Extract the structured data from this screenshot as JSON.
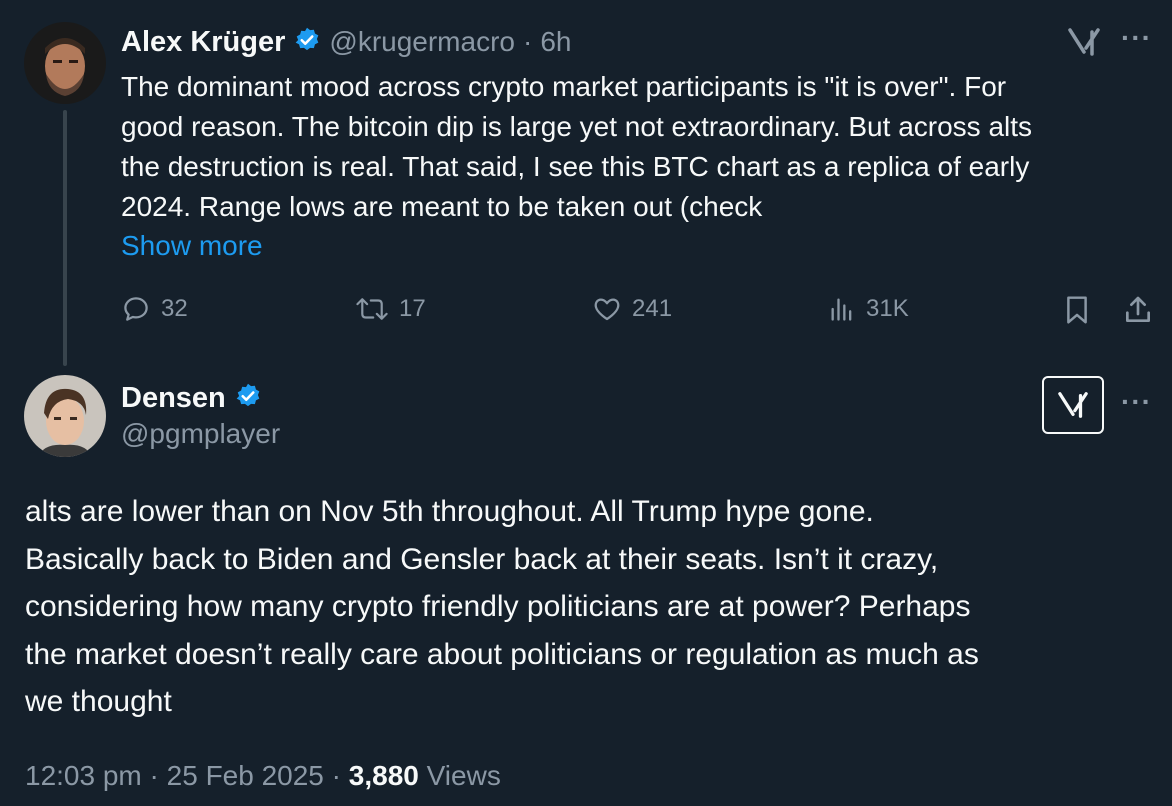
{
  "quoted_tweet": {
    "author_name": "Alex Krüger",
    "handle": "@krugermacro",
    "separator": "·",
    "time_ago": "6h",
    "text_lines": [
      "The dominant mood across crypto market participants is \"it is over\".  For",
      "good reason. The bitcoin dip is large yet not extraordinary. But across alts",
      "the destruction is real. That said, I see this BTC chart as a replica of early",
      "2024. Range lows are meant to be taken out (check"
    ],
    "show_more": "Show more",
    "replies": "32",
    "reposts": "17",
    "likes": "241",
    "views": "31K"
  },
  "main_tweet": {
    "author_name": "Densen",
    "handle": "@pgmplayer",
    "text_lines": [
      "alts are lower than on Nov 5th throughout. All Trump hype gone.",
      "Basically back to Biden and Gensler back at their seats. Isn’t it crazy,",
      "considering how many crypto friendly politicians are at power? Perhaps",
      "the market doesn’t really care about politicians or regulation as much as",
      "we thought"
    ],
    "time": "12:03 pm",
    "sep1": "·",
    "date": "25 Feb 2025",
    "sep2": "·",
    "view_count": "3,880",
    "views_label": "Views"
  },
  "icons": {
    "verified": "verified-badge-icon",
    "grok": "grok-icon",
    "more": "more-icon",
    "reply": "reply-icon",
    "repost": "repost-icon",
    "like": "like-icon",
    "views": "views-icon",
    "bookmark": "bookmark-icon",
    "share": "share-icon"
  },
  "colors": {
    "background": "#15202b",
    "text": "#f7f9f9",
    "muted": "#8b98a5",
    "accent": "#1d9bf0"
  },
  "more_glyph": "···"
}
